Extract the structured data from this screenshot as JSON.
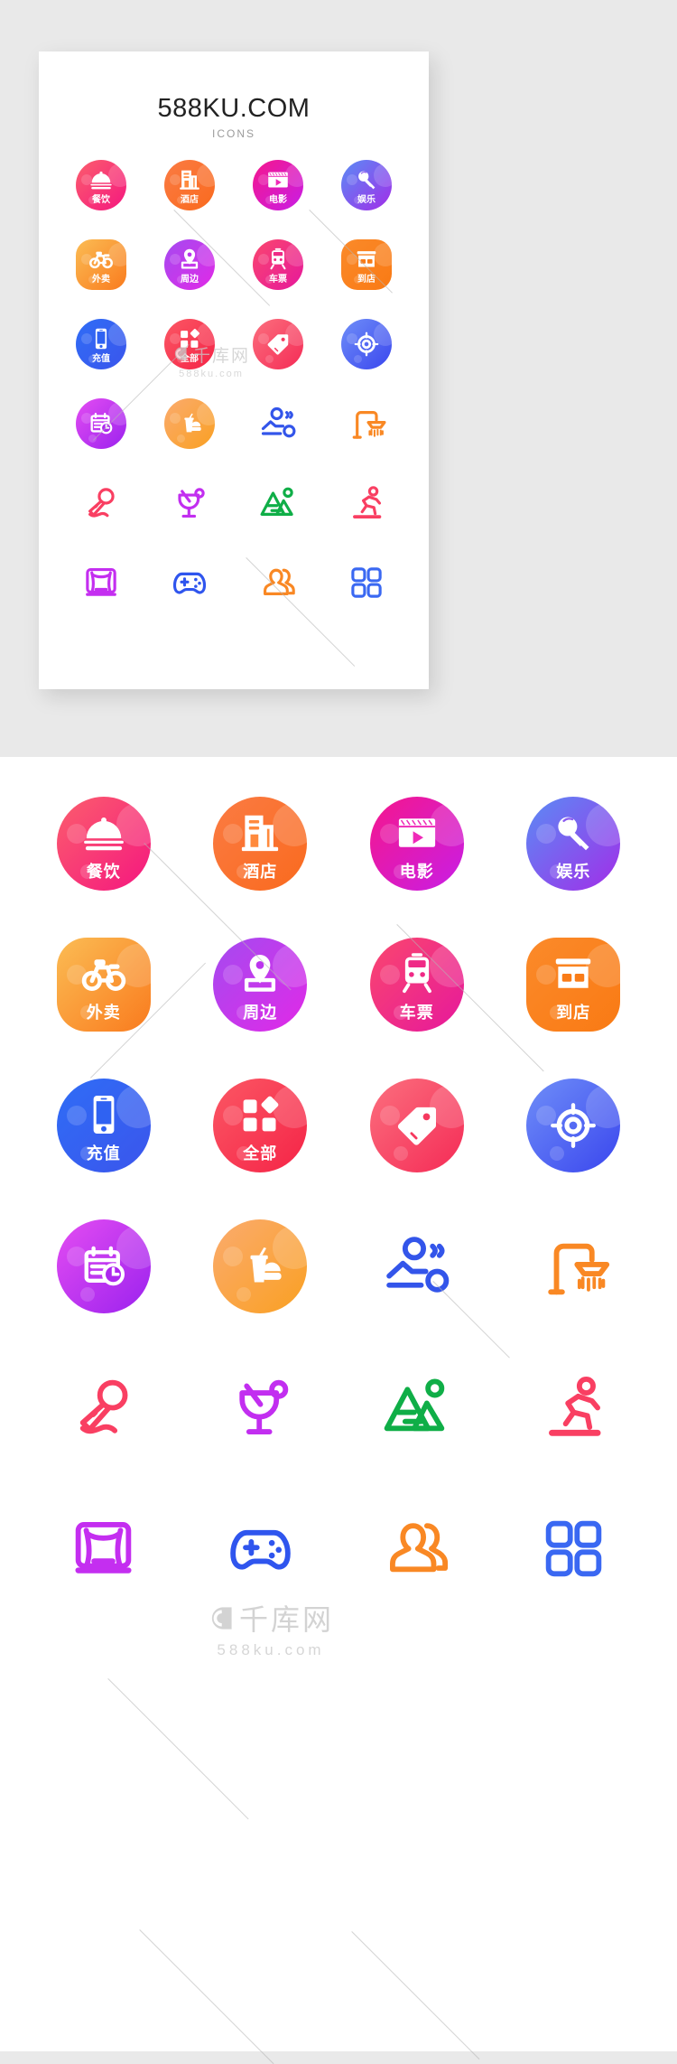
{
  "brand": {
    "title": "588KU.COM",
    "subtitle": "ICONS"
  },
  "watermark": {
    "line1": "千库网",
    "line2": "588ku.com"
  },
  "colors": {
    "page_background": "#e9e9e9",
    "card_background": "#ffffff",
    "title_color": "#222222",
    "subtitle_color": "#9b9b9b",
    "watermark_color": "#c9c9c9"
  },
  "icons": [
    {
      "label": "餐饮",
      "icon_name": "food-cloche-icon",
      "style": "filled-badge",
      "shape": "circle",
      "gradient_from": "#fb5e6d",
      "gradient_to": "#f5177f",
      "glyph_color": "#ffffff"
    },
    {
      "label": "酒店",
      "icon_name": "hotel-building-icon",
      "style": "filled-badge",
      "shape": "circle",
      "gradient_from": "#fb7b43",
      "gradient_to": "#f96a1e",
      "glyph_color": "#ffffff"
    },
    {
      "label": "电影",
      "icon_name": "movie-clapper-play-icon",
      "style": "filled-badge",
      "shape": "circle",
      "gradient_from": "#f5178c",
      "gradient_to": "#c81ee6",
      "glyph_color": "#ffffff"
    },
    {
      "label": "娱乐",
      "icon_name": "microphone-icon",
      "style": "filled-badge",
      "shape": "circle",
      "gradient_from": "#5a8cf5",
      "gradient_to": "#a22de8",
      "glyph_color": "#ffffff"
    },
    {
      "label": "外卖",
      "icon_name": "delivery-scooter-icon",
      "style": "filled-badge",
      "shape": "squircle",
      "gradient_from": "#fbbc54",
      "gradient_to": "#f97b1e",
      "glyph_color": "#ffffff"
    },
    {
      "label": "周边",
      "icon_name": "location-pin-icon",
      "style": "filled-badge",
      "shape": "circle",
      "gradient_from": "#a44bf0",
      "gradient_to": "#e129e7",
      "glyph_color": "#ffffff"
    },
    {
      "label": "车票",
      "icon_name": "train-ticket-icon",
      "style": "filled-badge",
      "shape": "circle",
      "gradient_from": "#fa476e",
      "gradient_to": "#e6189c",
      "glyph_color": "#ffffff"
    },
    {
      "label": "到店",
      "icon_name": "storefront-icon",
      "style": "filled-badge",
      "shape": "squircle",
      "gradient_from": "#fb8a2a",
      "gradient_to": "#f97a14",
      "glyph_color": "#ffffff"
    },
    {
      "label": "充值",
      "icon_name": "mobile-phone-recharge-icon",
      "style": "filled-badge",
      "shape": "circle",
      "gradient_from": "#2f6df6",
      "gradient_to": "#3b55ec",
      "glyph_color": "#ffffff"
    },
    {
      "label": "全部",
      "icon_name": "grid-all-categories-icon",
      "style": "filled-badge",
      "shape": "circle",
      "gradient_from": "#fb5764",
      "gradient_to": "#f52447",
      "glyph_color": "#ffffff"
    },
    {
      "label": "",
      "icon_name": "price-tag-icon",
      "style": "filled-badge",
      "shape": "circle",
      "gradient_from": "#fb6f7e",
      "gradient_to": "#f52b56",
      "glyph_color": "#ffffff"
    },
    {
      "label": "",
      "icon_name": "target-crosshair-icon",
      "style": "filled-badge",
      "shape": "circle",
      "gradient_from": "#6f8ef8",
      "gradient_to": "#3a46ee",
      "glyph_color": "#ffffff"
    },
    {
      "label": "",
      "icon_name": "calendar-clock-booking-icon",
      "style": "filled-badge",
      "shape": "circle",
      "gradient_from": "#e44df2",
      "gradient_to": "#9b22ee",
      "glyph_color": "#ffffff"
    },
    {
      "label": "",
      "icon_name": "fast-food-drink-icon",
      "style": "filled-badge",
      "shape": "circle",
      "gradient_from": "#fbab6e",
      "gradient_to": "#f9a022",
      "glyph_color": "#ffffff"
    },
    {
      "label": "",
      "icon_name": "massage-spa-icon",
      "style": "outline",
      "shape": "none",
      "gradient_from": "#3b5ae8",
      "gradient_to": "#2f4fe0",
      "glyph_color": "#3355ea"
    },
    {
      "label": "",
      "icon_name": "shower-icon",
      "style": "outline",
      "shape": "none",
      "gradient_from": "#f98824",
      "gradient_to": "#f97a14",
      "glyph_color": "#f98824"
    },
    {
      "label": "",
      "icon_name": "ktv-microphone-icon",
      "style": "outline",
      "shape": "none",
      "gradient_from": "#fb3f66",
      "gradient_to": "#f52b56",
      "glyph_color": "#f93f62"
    },
    {
      "label": "",
      "icon_name": "cocktail-glass-icon",
      "style": "outline",
      "shape": "none",
      "gradient_from": "#a33cf0",
      "gradient_to": "#e22bec",
      "glyph_color": "#c22ef0"
    },
    {
      "label": "",
      "icon_name": "mountain-scenery-icon",
      "style": "outline",
      "shape": "none",
      "gradient_from": "#11b14a",
      "gradient_to": "#0aa342",
      "glyph_color": "#0fae47"
    },
    {
      "label": "",
      "icon_name": "running-person-icon",
      "style": "outline",
      "shape": "none",
      "gradient_from": "#fb3f66",
      "gradient_to": "#f52b56",
      "glyph_color": "#f93f62"
    },
    {
      "label": "",
      "icon_name": "theater-stage-curtain-icon",
      "style": "outline",
      "shape": "none",
      "gradient_from": "#9b2df0",
      "gradient_to": "#e61fe6",
      "glyph_color": "#c42ef0"
    },
    {
      "label": "",
      "icon_name": "game-controller-icon",
      "style": "outline",
      "shape": "none",
      "gradient_from": "#2f5af0",
      "gradient_to": "#2a4fe8",
      "glyph_color": "#2f55ee"
    },
    {
      "label": "",
      "icon_name": "people-group-icon",
      "style": "outline",
      "shape": "none",
      "gradient_from": "#f98824",
      "gradient_to": "#f97a14",
      "glyph_color": "#f98824"
    },
    {
      "label": "",
      "icon_name": "four-squares-grid-icon",
      "style": "outline",
      "shape": "none",
      "gradient_from": "#3f6cf5",
      "gradient_to": "#2f5aee",
      "glyph_color": "#3a68f2"
    }
  ]
}
